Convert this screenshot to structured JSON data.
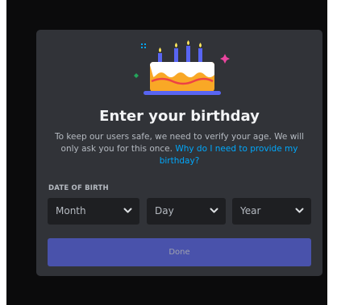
{
  "modal": {
    "title": "Enter your birthday",
    "description": "To keep our users safe, we need to verify your age. We will only ask you for this once.",
    "help_link": "Why do I need to provide my birthday?",
    "dob_label": "DATE OF BIRTH",
    "month_placeholder": "Month",
    "day_placeholder": "Day",
    "year_placeholder": "Year",
    "done_label": "Done"
  },
  "icons": {
    "illustration": "birthday-cake-icon",
    "dropdown": "chevron-down-icon"
  },
  "colors": {
    "modal_bg": "#313338",
    "input_bg": "#1e1f22",
    "link": "#00a8fc",
    "button": "#5865f2",
    "title": "#f2f3f5",
    "muted": "#b5bac1"
  }
}
